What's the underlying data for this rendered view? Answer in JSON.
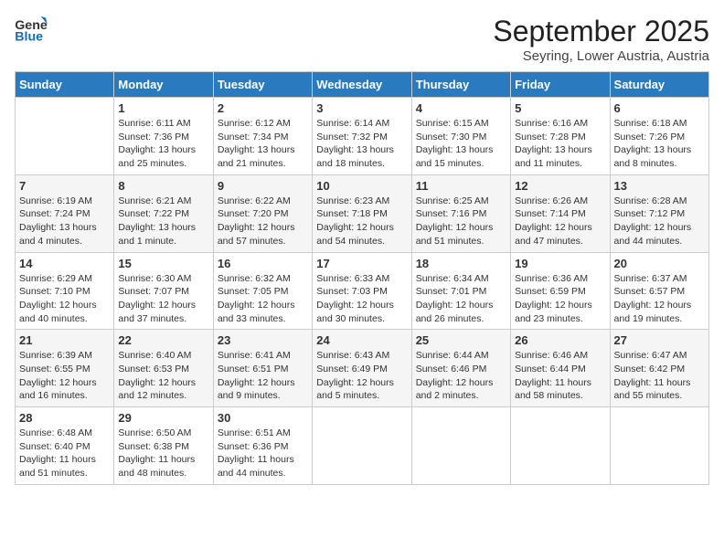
{
  "header": {
    "logo_line1": "General",
    "logo_line2": "Blue",
    "title": "September 2025",
    "subtitle": "Seyring, Lower Austria, Austria"
  },
  "days_of_week": [
    "Sunday",
    "Monday",
    "Tuesday",
    "Wednesday",
    "Thursday",
    "Friday",
    "Saturday"
  ],
  "weeks": [
    [
      {
        "day": "",
        "sunrise": "",
        "sunset": "",
        "daylight": ""
      },
      {
        "day": "1",
        "sunrise": "Sunrise: 6:11 AM",
        "sunset": "Sunset: 7:36 PM",
        "daylight": "Daylight: 13 hours and 25 minutes."
      },
      {
        "day": "2",
        "sunrise": "Sunrise: 6:12 AM",
        "sunset": "Sunset: 7:34 PM",
        "daylight": "Daylight: 13 hours and 21 minutes."
      },
      {
        "day": "3",
        "sunrise": "Sunrise: 6:14 AM",
        "sunset": "Sunset: 7:32 PM",
        "daylight": "Daylight: 13 hours and 18 minutes."
      },
      {
        "day": "4",
        "sunrise": "Sunrise: 6:15 AM",
        "sunset": "Sunset: 7:30 PM",
        "daylight": "Daylight: 13 hours and 15 minutes."
      },
      {
        "day": "5",
        "sunrise": "Sunrise: 6:16 AM",
        "sunset": "Sunset: 7:28 PM",
        "daylight": "Daylight: 13 hours and 11 minutes."
      },
      {
        "day": "6",
        "sunrise": "Sunrise: 6:18 AM",
        "sunset": "Sunset: 7:26 PM",
        "daylight": "Daylight: 13 hours and 8 minutes."
      }
    ],
    [
      {
        "day": "7",
        "sunrise": "Sunrise: 6:19 AM",
        "sunset": "Sunset: 7:24 PM",
        "daylight": "Daylight: 13 hours and 4 minutes."
      },
      {
        "day": "8",
        "sunrise": "Sunrise: 6:21 AM",
        "sunset": "Sunset: 7:22 PM",
        "daylight": "Daylight: 13 hours and 1 minute."
      },
      {
        "day": "9",
        "sunrise": "Sunrise: 6:22 AM",
        "sunset": "Sunset: 7:20 PM",
        "daylight": "Daylight: 12 hours and 57 minutes."
      },
      {
        "day": "10",
        "sunrise": "Sunrise: 6:23 AM",
        "sunset": "Sunset: 7:18 PM",
        "daylight": "Daylight: 12 hours and 54 minutes."
      },
      {
        "day": "11",
        "sunrise": "Sunrise: 6:25 AM",
        "sunset": "Sunset: 7:16 PM",
        "daylight": "Daylight: 12 hours and 51 minutes."
      },
      {
        "day": "12",
        "sunrise": "Sunrise: 6:26 AM",
        "sunset": "Sunset: 7:14 PM",
        "daylight": "Daylight: 12 hours and 47 minutes."
      },
      {
        "day": "13",
        "sunrise": "Sunrise: 6:28 AM",
        "sunset": "Sunset: 7:12 PM",
        "daylight": "Daylight: 12 hours and 44 minutes."
      }
    ],
    [
      {
        "day": "14",
        "sunrise": "Sunrise: 6:29 AM",
        "sunset": "Sunset: 7:10 PM",
        "daylight": "Daylight: 12 hours and 40 minutes."
      },
      {
        "day": "15",
        "sunrise": "Sunrise: 6:30 AM",
        "sunset": "Sunset: 7:07 PM",
        "daylight": "Daylight: 12 hours and 37 minutes."
      },
      {
        "day": "16",
        "sunrise": "Sunrise: 6:32 AM",
        "sunset": "Sunset: 7:05 PM",
        "daylight": "Daylight: 12 hours and 33 minutes."
      },
      {
        "day": "17",
        "sunrise": "Sunrise: 6:33 AM",
        "sunset": "Sunset: 7:03 PM",
        "daylight": "Daylight: 12 hours and 30 minutes."
      },
      {
        "day": "18",
        "sunrise": "Sunrise: 6:34 AM",
        "sunset": "Sunset: 7:01 PM",
        "daylight": "Daylight: 12 hours and 26 minutes."
      },
      {
        "day": "19",
        "sunrise": "Sunrise: 6:36 AM",
        "sunset": "Sunset: 6:59 PM",
        "daylight": "Daylight: 12 hours and 23 minutes."
      },
      {
        "day": "20",
        "sunrise": "Sunrise: 6:37 AM",
        "sunset": "Sunset: 6:57 PM",
        "daylight": "Daylight: 12 hours and 19 minutes."
      }
    ],
    [
      {
        "day": "21",
        "sunrise": "Sunrise: 6:39 AM",
        "sunset": "Sunset: 6:55 PM",
        "daylight": "Daylight: 12 hours and 16 minutes."
      },
      {
        "day": "22",
        "sunrise": "Sunrise: 6:40 AM",
        "sunset": "Sunset: 6:53 PM",
        "daylight": "Daylight: 12 hours and 12 minutes."
      },
      {
        "day": "23",
        "sunrise": "Sunrise: 6:41 AM",
        "sunset": "Sunset: 6:51 PM",
        "daylight": "Daylight: 12 hours and 9 minutes."
      },
      {
        "day": "24",
        "sunrise": "Sunrise: 6:43 AM",
        "sunset": "Sunset: 6:49 PM",
        "daylight": "Daylight: 12 hours and 5 minutes."
      },
      {
        "day": "25",
        "sunrise": "Sunrise: 6:44 AM",
        "sunset": "Sunset: 6:46 PM",
        "daylight": "Daylight: 12 hours and 2 minutes."
      },
      {
        "day": "26",
        "sunrise": "Sunrise: 6:46 AM",
        "sunset": "Sunset: 6:44 PM",
        "daylight": "Daylight: 11 hours and 58 minutes."
      },
      {
        "day": "27",
        "sunrise": "Sunrise: 6:47 AM",
        "sunset": "Sunset: 6:42 PM",
        "daylight": "Daylight: 11 hours and 55 minutes."
      }
    ],
    [
      {
        "day": "28",
        "sunrise": "Sunrise: 6:48 AM",
        "sunset": "Sunset: 6:40 PM",
        "daylight": "Daylight: 11 hours and 51 minutes."
      },
      {
        "day": "29",
        "sunrise": "Sunrise: 6:50 AM",
        "sunset": "Sunset: 6:38 PM",
        "daylight": "Daylight: 11 hours and 48 minutes."
      },
      {
        "day": "30",
        "sunrise": "Sunrise: 6:51 AM",
        "sunset": "Sunset: 6:36 PM",
        "daylight": "Daylight: 11 hours and 44 minutes."
      },
      {
        "day": "",
        "sunrise": "",
        "sunset": "",
        "daylight": ""
      },
      {
        "day": "",
        "sunrise": "",
        "sunset": "",
        "daylight": ""
      },
      {
        "day": "",
        "sunrise": "",
        "sunset": "",
        "daylight": ""
      },
      {
        "day": "",
        "sunrise": "",
        "sunset": "",
        "daylight": ""
      }
    ]
  ]
}
